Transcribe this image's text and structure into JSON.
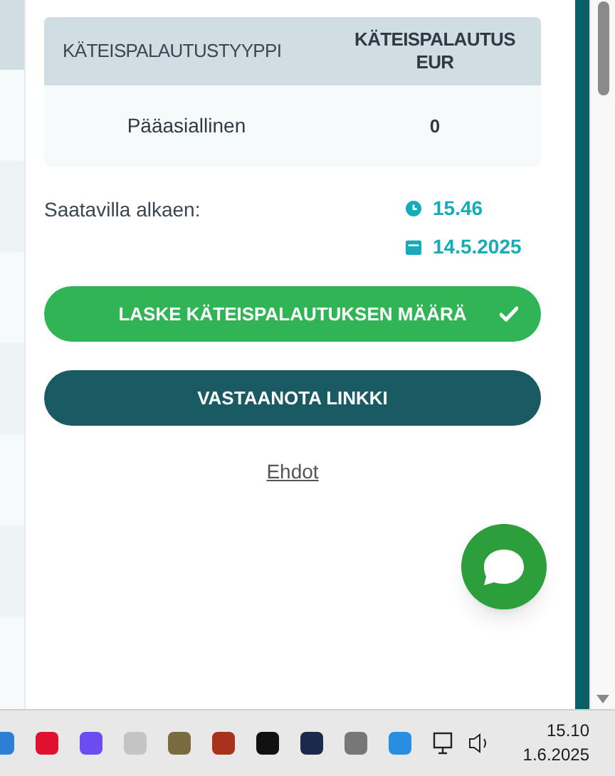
{
  "table": {
    "columns": [
      "KÄTEISPALAUTUSTYYPPI",
      "KÄTEISPALAUTUS EUR"
    ],
    "rows": [
      {
        "type": "Pääasiallinen",
        "amount": "0"
      }
    ]
  },
  "availability": {
    "label": "Saatavilla alkaen:",
    "time": "15.46",
    "date": "14.5.2025"
  },
  "buttons": [
    {
      "kind": "calculate",
      "label": "LASKE KÄTEISPALAUTUKSEN MÄÄRÄ",
      "completed": true
    },
    {
      "kind": "link",
      "label": "VASTAANOTA LINKKI",
      "completed": false
    }
  ],
  "terms_link": "Ehdot",
  "taskbar": {
    "time": "15.10",
    "date": "1.6.2025"
  }
}
